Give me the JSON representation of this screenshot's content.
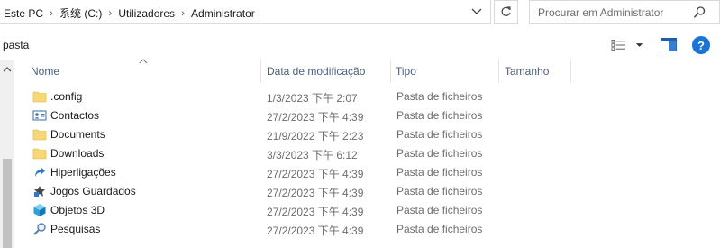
{
  "address_bar": {
    "breadcrumbs": [
      "Este PC",
      "系统 (C:)",
      "Utilizadores",
      "Administrator"
    ]
  },
  "search": {
    "placeholder": "Procurar em Administrator"
  },
  "toolbar": {
    "label": "pasta"
  },
  "columns": {
    "name": "Nome",
    "date": "Data de modificação",
    "type": "Tipo",
    "size": "Tamanho"
  },
  "files": [
    {
      "name": ".config",
      "date": "1/3/2023 下午 2:07",
      "type": "Pasta de ficheiros",
      "icon": "folder-icon"
    },
    {
      "name": "Contactos",
      "date": "27/2/2023 下午 4:39",
      "type": "Pasta de ficheiros",
      "icon": "contacts-icon"
    },
    {
      "name": "Documents",
      "date": "21/9/2022 下午 2:23",
      "type": "Pasta de ficheiros",
      "icon": "folder-icon"
    },
    {
      "name": "Downloads",
      "date": "3/3/2023 下午 6:12",
      "type": "Pasta de ficheiros",
      "icon": "folder-icon"
    },
    {
      "name": "Hiperligações",
      "date": "27/2/2023 下午 4:39",
      "type": "Pasta de ficheiros",
      "icon": "links-icon"
    },
    {
      "name": "Jogos Guardados",
      "date": "27/2/2023 下午 4:39",
      "type": "Pasta de ficheiros",
      "icon": "saved-games-icon"
    },
    {
      "name": "Objetos 3D",
      "date": "27/2/2023 下午 4:39",
      "type": "Pasta de ficheiros",
      "icon": "3d-objects-icon"
    },
    {
      "name": "Pesquisas",
      "date": "27/2/2023 下午 4:39",
      "type": "Pasta de ficheiros",
      "icon": "searches-icon"
    }
  ],
  "colors": {
    "header_text": "#4c607a",
    "folder": "#f8d775",
    "accent": "#1a73d6"
  }
}
